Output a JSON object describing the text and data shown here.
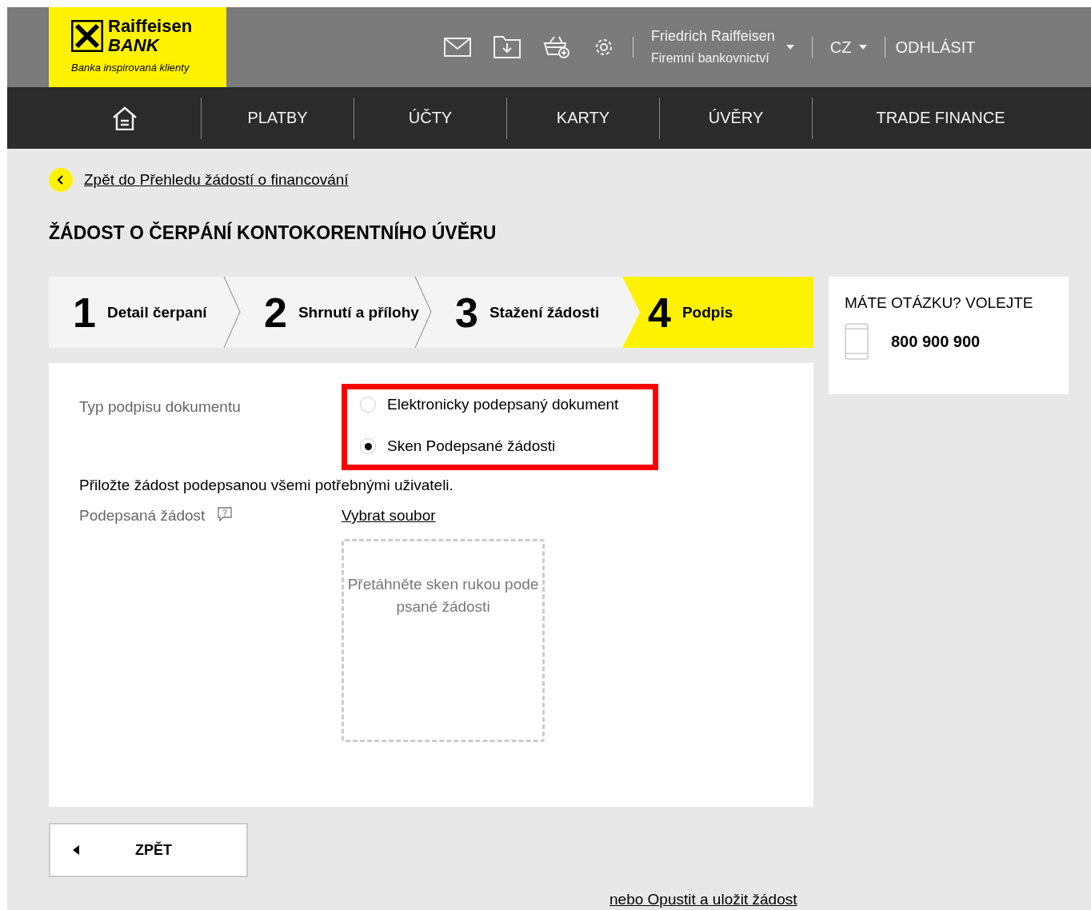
{
  "header": {
    "logo": {
      "brand": "Raiffeisen",
      "brand_line2": "BANK",
      "tagline": "Banka inspirovaná klienty"
    },
    "user": {
      "name": "Friedrich Raiffeisen",
      "subtitle": "Firemní bankovnictví"
    },
    "language": "CZ",
    "logout": "ODHLÁSIT"
  },
  "nav": {
    "items": [
      {
        "label": "PLATBY"
      },
      {
        "label": "ÚČTY"
      },
      {
        "label": "KARTY"
      },
      {
        "label": "ÚVĚRY"
      },
      {
        "label": "TRADE FINANCE"
      }
    ]
  },
  "back_link": "Zpět do Přehledu žádostí o financování",
  "title": "ŽÁDOST O ČERPÁNÍ KONTOKORENTNÍHO ÚVĚRU",
  "steps": [
    {
      "number": "1",
      "label": "Detail čerpaní",
      "selected": false
    },
    {
      "number": "2",
      "label": "Shrnutí a přílohy",
      "selected": false
    },
    {
      "number": "3",
      "label": "Stažení žádosti",
      "selected": false
    },
    {
      "number": "4",
      "label": "Podpis",
      "selected": true
    }
  ],
  "help": {
    "title": "MÁTE OTÁZKU? VOLEJTE",
    "phone": "800 900 900"
  },
  "form": {
    "signature_label": "Typ podpisu dokumentu",
    "options": [
      {
        "label": "Elektronicky podepsaný dokument",
        "selected": false
      },
      {
        "label": "Sken Podepsané žádosti",
        "selected": true
      }
    ],
    "instruction": "Přiložte žádost podepsanou všemi potřebnými uživateli.",
    "file_label": "Podepsaná žádost",
    "file_link": "Vybrat soubor",
    "drop_hint": "Přetáhněte sken rukou podepsané žádosti"
  },
  "back_button": "ZPĚT",
  "leave_link": "nebo Opustit a uložit žádost"
}
